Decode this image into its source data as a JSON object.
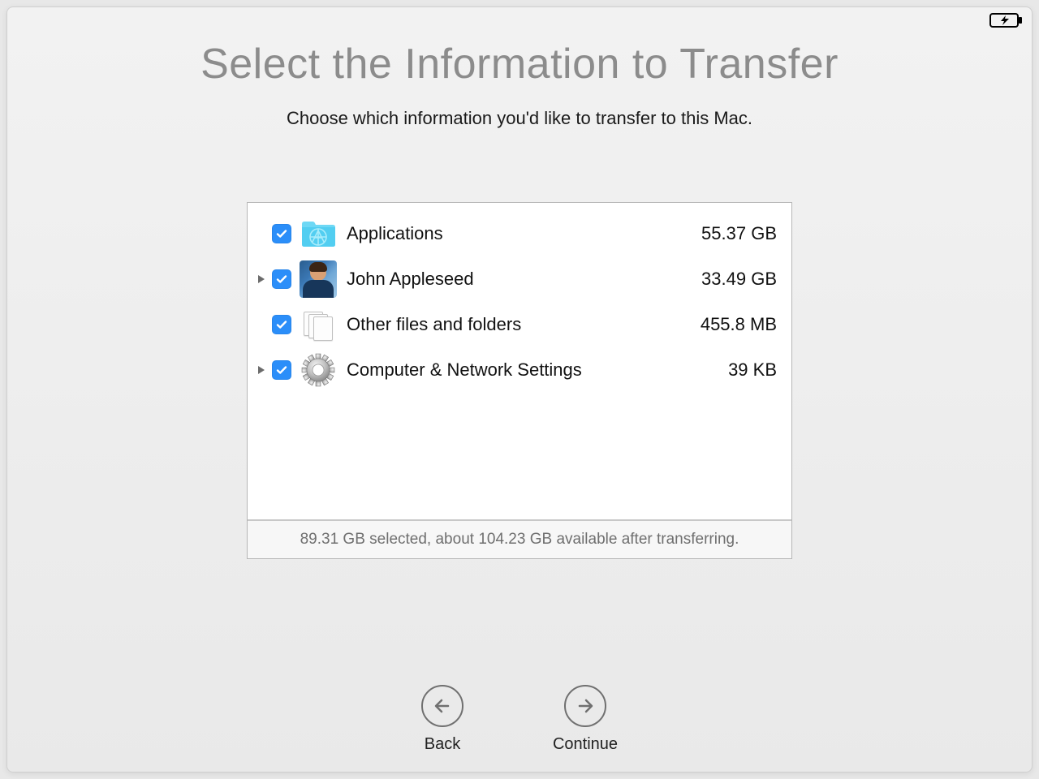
{
  "title": "Select the Information to Transfer",
  "subtitle": "Choose which information you'd like to transfer to this Mac.",
  "items": [
    {
      "label": "Applications",
      "size": "55.37 GB",
      "checked": true,
      "expandable": false,
      "icon": "applications"
    },
    {
      "label": "John Appleseed",
      "size": "33.49 GB",
      "checked": true,
      "expandable": true,
      "icon": "avatar"
    },
    {
      "label": "Other files and folders",
      "size": "455.8 MB",
      "checked": true,
      "expandable": false,
      "icon": "files"
    },
    {
      "label": "Computer & Network Settings",
      "size": "39 KB",
      "checked": true,
      "expandable": true,
      "icon": "gear"
    }
  ],
  "summary": "89.31 GB selected, about 104.23 GB available after transferring.",
  "nav": {
    "back": "Back",
    "continue": "Continue"
  }
}
